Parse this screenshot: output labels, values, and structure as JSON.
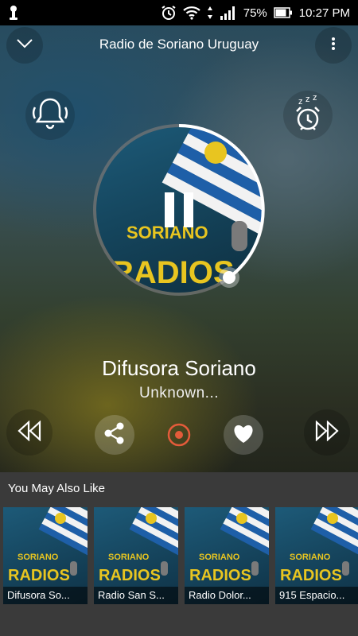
{
  "status_bar": {
    "battery_percent": "75%",
    "time": "10:27 PM",
    "icons": [
      "notification-icon",
      "alarm-icon",
      "wifi-icon",
      "signal-icon",
      "battery-icon"
    ]
  },
  "header": {
    "title": "Radio de Soriano Uruguay",
    "left_icon": "chevron-down-icon",
    "right_icon": "more-vert-icon"
  },
  "side_buttons": {
    "left_icon": "bell-icon",
    "right_icon": "alarm-clock-sleep-icon"
  },
  "now_playing": {
    "artwork_text_top": "SORIANO",
    "artwork_text_bottom": "RADIOS",
    "state_icon": "pause-icon",
    "station": "Difusora Soriano",
    "artist": "Unknown..."
  },
  "controls": {
    "prev_icon": "rewind-icon",
    "share_icon": "share-icon",
    "record_icon": "record-icon",
    "favorite_icon": "heart-icon",
    "next_icon": "fast-forward-icon"
  },
  "related": {
    "title": "You May Also Like",
    "items": [
      {
        "name": "Difusora So...",
        "art_top": "SORIANO",
        "art_bottom": "RADIOS"
      },
      {
        "name": "Radio San S...",
        "art_top": "SORIANO",
        "art_bottom": "RADIOS"
      },
      {
        "name": "Radio Dolor...",
        "art_top": "SORIANO",
        "art_bottom": "RADIOS"
      },
      {
        "name": "915 Espacio...",
        "art_top": "SORIANO",
        "art_bottom": "RADIOS"
      }
    ]
  },
  "colors": {
    "accent_yellow": "#e8c520",
    "record_red": "#e35b3a",
    "related_bg": "#3a3a3a"
  }
}
